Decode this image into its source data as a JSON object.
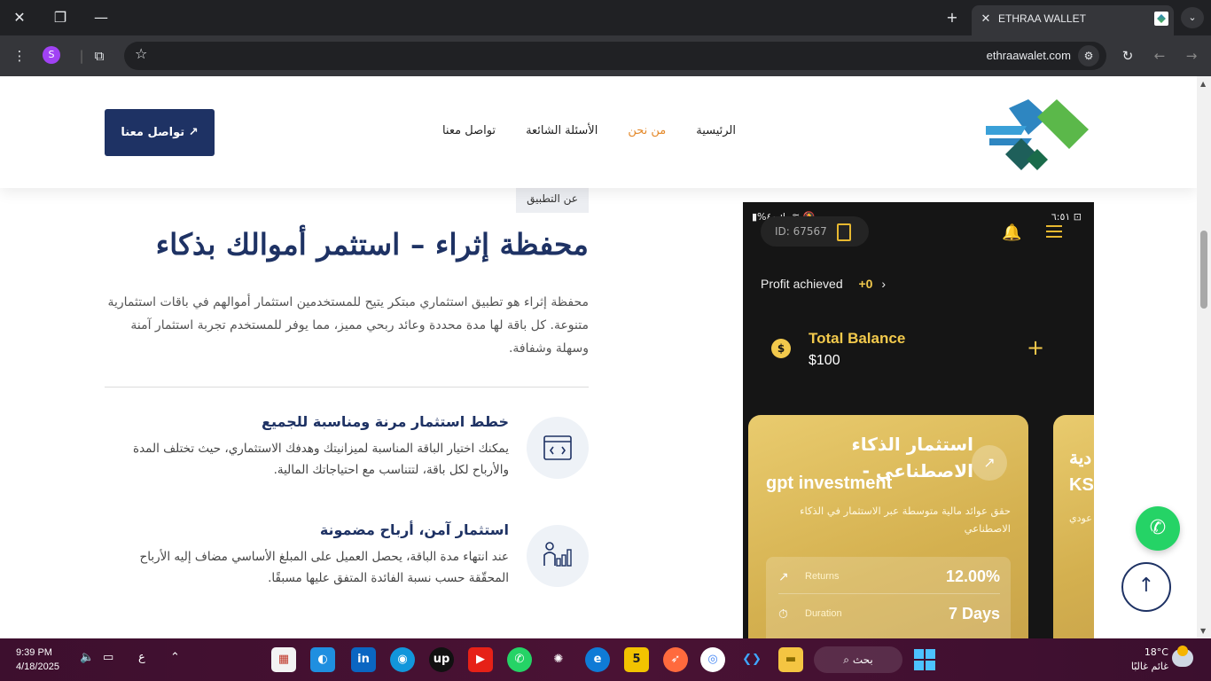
{
  "browser": {
    "tab_title": "ETHRAA WALLET",
    "url": "ethraawalet.com",
    "profile_initial": "S"
  },
  "header": {
    "nav": [
      "الرئيسية",
      "من نحن",
      "الأسئلة الشائعة",
      "تواصل معنا"
    ],
    "active_nav": "من نحن",
    "cta_label": "تواصل معنا ↗"
  },
  "about": {
    "badge": "عن التطبيق",
    "headline": "محفظة إثراء – استثمر أموالك بذكاء",
    "intro": "محفظة إثراء هو تطبيق استثماري مبتكر يتيح للمستخدمين استثمار أموالهم في باقات استثمارية متنوعة. كل باقة لها مدة محددة وعائد ربحي مميز، مما يوفر للمستخدم تجربة استثمار آمنة وسهلة وشفافة.",
    "features": [
      {
        "title": "خطط استثمار مرنة ومناسبة للجميع",
        "text": "يمكنك اختيار الباقة المناسبة لميزانيتك وهدفك الاستثماري، حيث تختلف المدة والأرباح لكل باقة، لتتناسب مع احتياجاتك المالية.",
        "icon": "code-window-icon"
      },
      {
        "title": "استثمار آمن، أرباح مضمونة",
        "text": "عند انتهاء مدة الباقة، يحصل العميل على المبلغ الأساسي مضاف إليه الأرباح المحقّقة حسب نسبة الفائدة المتفق عليها مسبقًا.",
        "icon": "growth-chart-icon"
      }
    ]
  },
  "app_mockup": {
    "status_left": "▮%٤٠ ıl. ≋ 🔕",
    "status_right": "٦:٥١ ⊡",
    "user_id": "ID: 67567",
    "profit_label": "Profit achieved",
    "profit_value": "+0",
    "balance_label": "Total Balance",
    "balance_value": "$100",
    "card1": {
      "title": "استثمار الذكاء الاصطناعي -",
      "subtitle": "gpt investment",
      "description": "حقق عوائد مالية متوسطة عبر الاستثمار في الذكاء الاصطناعي",
      "returns_label": "Returns",
      "returns_value": "12.00%",
      "duration_label": "Duration",
      "duration_value": "7 Days"
    },
    "card2": {
      "title_partial": "دية",
      "subtitle_partial": "KS",
      "desc_partial": "عودي"
    }
  },
  "taskbar": {
    "time": "9:39 PM",
    "date": "4/18/2025",
    "lang": "ع",
    "search_label": "بحث",
    "weather_temp": "18°C",
    "weather_desc": "غائم غالبًا",
    "apps": [
      "slides",
      "edge-alt",
      "linkedin",
      "tasks",
      "upwork",
      "youtube",
      "whatsapp",
      "chatgpt",
      "edge",
      "5",
      "compass",
      "chrome",
      "vscode",
      "files"
    ]
  },
  "colors": {
    "brand_navy": "#1e3264",
    "active_orange": "#e48a2c",
    "gold": "#f2c94c",
    "whatsapp_green": "#25d366"
  }
}
